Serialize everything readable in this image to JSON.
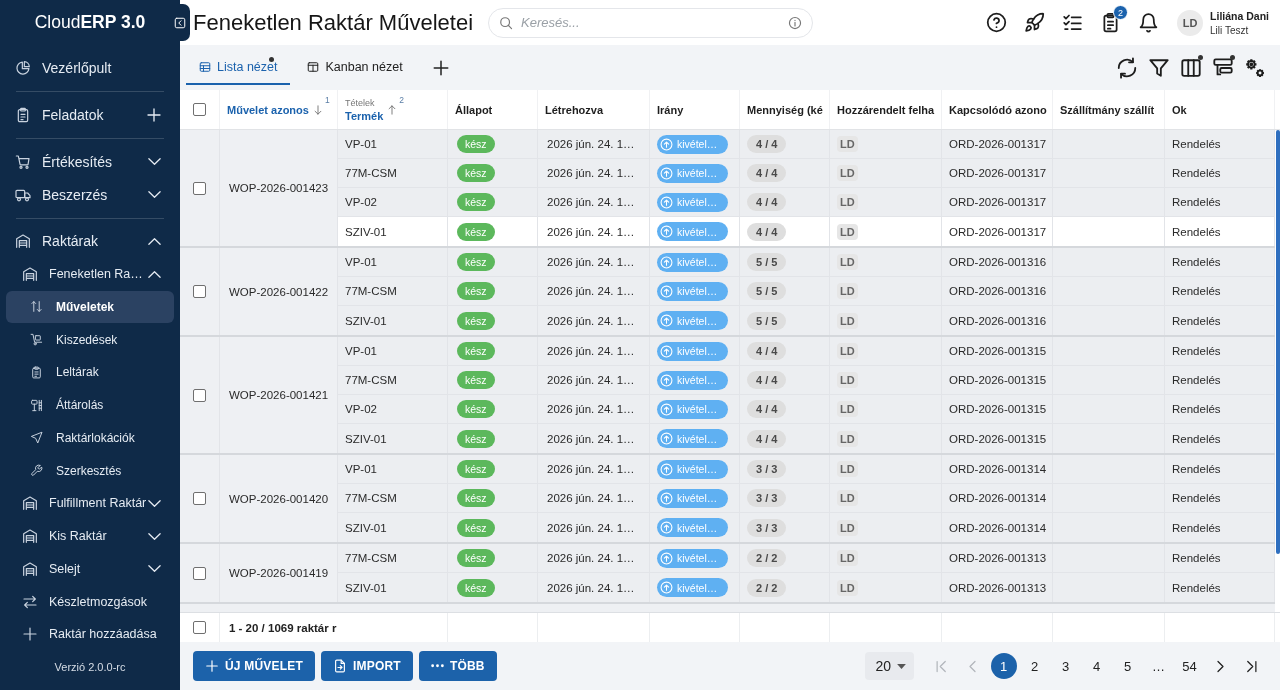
{
  "app": {
    "brand": "Cloud**ERP 3.0**",
    "version": "Verzió 2.0.0-rc"
  },
  "sidebar": {
    "sections": [
      {
        "items": [
          {
            "label": "Vezérlőpult",
            "selected": false
          }
        ]
      },
      {
        "items": [
          {
            "label": "Feladatok",
            "add_button": true,
            "selected": false
          }
        ]
      },
      {
        "items": [
          {
            "label": "Értékesítés",
            "expanded": false,
            "selected": false
          },
          {
            "label": "Beszerzés",
            "expanded": false,
            "selected": false
          }
        ]
      },
      {
        "items": [
          {
            "label": "Raktárak",
            "expanded": true,
            "selected": false,
            "children": [
              {
                "label": "Feneketlen Ra…",
                "expanded": true,
                "selected": false,
                "children": [
                  {
                    "label": "Műveletek",
                    "selected": true
                  },
                  {
                    "label": "Kiszedések",
                    "selected": false
                  },
                  {
                    "label": "Leltárak",
                    "selected": false
                  },
                  {
                    "label": "Áttárolás",
                    "selected": false
                  },
                  {
                    "label": "Raktárlokációk",
                    "selected": false
                  },
                  {
                    "label": "Szerkesztés",
                    "selected": false
                  }
                ]
              },
              {
                "label": "Fulfillment Raktár",
                "expanded": false,
                "selected": false
              },
              {
                "label": "Kis Raktár",
                "expanded": false,
                "selected": false
              },
              {
                "label": "Selejt",
                "expanded": false,
                "selected": false
              },
              {
                "label": "Készletmozgások",
                "selected": false
              },
              {
                "label": "Raktár hozzáadása",
                "selected": false
              }
            ]
          }
        ]
      }
    ]
  },
  "header": {
    "title": "Feneketlen Raktár Műveletei",
    "search": {
      "placeholder": "Keresés..."
    },
    "badge": "2",
    "user": {
      "initials": "LD",
      "name": "Liliána Dani",
      "role": "Lili Teszt"
    }
  },
  "toolbar": {
    "tabs": [
      {
        "label": "Lista nézet",
        "selected": true,
        "indicator": true
      },
      {
        "label": "Kanban nézet",
        "selected": false,
        "indicator": false
      }
    ],
    "actions": [
      {
        "indicator": false
      },
      {
        "indicator": false
      },
      {
        "indicator": true
      },
      {
        "indicator": true
      },
      {
        "indicator": false
      }
    ]
  },
  "table": {
    "select_all": false,
    "columns": [
      {
        "label": "Művelet azonos",
        "sort": {
          "descending": true,
          "index": "1"
        }
      },
      {
        "group_label": "Tételek",
        "label": "Termék",
        "sort": {
          "descending": false,
          "index": "2"
        }
      },
      {
        "label": "Állapot"
      },
      {
        "label": "Létrehozva"
      },
      {
        "label": "Irány"
      },
      {
        "label": "Mennyiség (ké"
      },
      {
        "label": "Hozzárendelt felha"
      },
      {
        "label": "Kapcsolódó azono"
      },
      {
        "label": "Szállítmány szállít"
      },
      {
        "label": "Ok"
      }
    ],
    "groups": [
      {
        "id": "WOP-2026-001423",
        "checked": false,
        "items": [
          {
            "product": "VP-01",
            "status": "kész",
            "created": "2026 jún. 24. 1…",
            "direction": "kivétel…",
            "quantity": "4 / 4",
            "assignee": "LD",
            "related": "ORD-2026-001317",
            "reason": "Rendelés",
            "hovered": false
          },
          {
            "product": "77M-CSM",
            "status": "kész",
            "created": "2026 jún. 24. 1…",
            "direction": "kivétel…",
            "quantity": "4 / 4",
            "assignee": "LD",
            "related": "ORD-2026-001317",
            "reason": "Rendelés",
            "hovered": false
          },
          {
            "product": "VP-02",
            "status": "kész",
            "created": "2026 jún. 24. 1…",
            "direction": "kivétel…",
            "quantity": "4 / 4",
            "assignee": "LD",
            "related": "ORD-2026-001317",
            "reason": "Rendelés",
            "hovered": false
          },
          {
            "product": "SZIV-01",
            "status": "kész",
            "created": "2026 jún. 24. 1…",
            "direction": "kivétel…",
            "quantity": "4 / 4",
            "assignee": "LD",
            "related": "ORD-2026-001317",
            "reason": "Rendelés",
            "hovered": true
          }
        ]
      },
      {
        "id": "WOP-2026-001422",
        "checked": false,
        "items": [
          {
            "product": "VP-01",
            "status": "kész",
            "created": "2026 jún. 24. 1…",
            "direction": "kivétel…",
            "quantity": "5 / 5",
            "assignee": "LD",
            "related": "ORD-2026-001316",
            "reason": "Rendelés",
            "hovered": false
          },
          {
            "product": "77M-CSM",
            "status": "kész",
            "created": "2026 jún. 24. 1…",
            "direction": "kivétel…",
            "quantity": "5 / 5",
            "assignee": "LD",
            "related": "ORD-2026-001316",
            "reason": "Rendelés",
            "hovered": false
          },
          {
            "product": "SZIV-01",
            "status": "kész",
            "created": "2026 jún. 24. 1…",
            "direction": "kivétel…",
            "quantity": "5 / 5",
            "assignee": "LD",
            "related": "ORD-2026-001316",
            "reason": "Rendelés",
            "hovered": false
          }
        ]
      },
      {
        "id": "WOP-2026-001421",
        "checked": false,
        "items": [
          {
            "product": "VP-01",
            "status": "kész",
            "created": "2026 jún. 24. 1…",
            "direction": "kivétel…",
            "quantity": "4 / 4",
            "assignee": "LD",
            "related": "ORD-2026-001315",
            "reason": "Rendelés",
            "hovered": false
          },
          {
            "product": "77M-CSM",
            "status": "kész",
            "created": "2026 jún. 24. 1…",
            "direction": "kivétel…",
            "quantity": "4 / 4",
            "assignee": "LD",
            "related": "ORD-2026-001315",
            "reason": "Rendelés",
            "hovered": false
          },
          {
            "product": "VP-02",
            "status": "kész",
            "created": "2026 jún. 24. 1…",
            "direction": "kivétel…",
            "quantity": "4 / 4",
            "assignee": "LD",
            "related": "ORD-2026-001315",
            "reason": "Rendelés",
            "hovered": false
          },
          {
            "product": "SZIV-01",
            "status": "kész",
            "created": "2026 jún. 24. 1…",
            "direction": "kivétel…",
            "quantity": "4 / 4",
            "assignee": "LD",
            "related": "ORD-2026-001315",
            "reason": "Rendelés",
            "hovered": false
          }
        ]
      },
      {
        "id": "WOP-2026-001420",
        "checked": false,
        "items": [
          {
            "product": "VP-01",
            "status": "kész",
            "created": "2026 jún. 24. 1…",
            "direction": "kivétel…",
            "quantity": "3 / 3",
            "assignee": "LD",
            "related": "ORD-2026-001314",
            "reason": "Rendelés",
            "hovered": false
          },
          {
            "product": "77M-CSM",
            "status": "kész",
            "created": "2026 jún. 24. 1…",
            "direction": "kivétel…",
            "quantity": "3 / 3",
            "assignee": "LD",
            "related": "ORD-2026-001314",
            "reason": "Rendelés",
            "hovered": false
          },
          {
            "product": "SZIV-01",
            "status": "kész",
            "created": "2026 jún. 24. 1…",
            "direction": "kivétel…",
            "quantity": "3 / 3",
            "assignee": "LD",
            "related": "ORD-2026-001314",
            "reason": "Rendelés",
            "hovered": false
          }
        ]
      },
      {
        "id": "WOP-2026-001419",
        "checked": false,
        "items": [
          {
            "product": "77M-CSM",
            "status": "kész",
            "created": "2026 jún. 24. 1…",
            "direction": "kivétel…",
            "quantity": "2 / 2",
            "assignee": "LD",
            "related": "ORD-2026-001313",
            "reason": "Rendelés",
            "hovered": false
          },
          {
            "product": "SZIV-01",
            "status": "kész",
            "created": "2026 jún. 24. 1…",
            "direction": "kivétel…",
            "quantity": "2 / 2",
            "assignee": "LD",
            "related": "ORD-2026-001313",
            "reason": "Rendelés",
            "hovered": false
          }
        ]
      }
    ],
    "footer": {
      "checked": false,
      "summary": "1 - 20 / 1069 raktár r"
    }
  },
  "bottom": {
    "actions": [
      {
        "label": "ÚJ MŰVELET"
      },
      {
        "label": "IMPORT"
      },
      {
        "label": "TÖBB"
      }
    ]
  },
  "pagination": {
    "page_size": "20",
    "nav_before": [
      {
        "disabled": true
      },
      {
        "disabled": true
      }
    ],
    "pages": [
      {
        "label": "1",
        "selected": true
      },
      {
        "label": "2",
        "selected": false
      },
      {
        "label": "3",
        "selected": false
      },
      {
        "label": "4",
        "selected": false
      },
      {
        "label": "5",
        "selected": false
      }
    ],
    "ellipsis": "…",
    "last_pages": [
      {
        "label": "54",
        "selected": false
      }
    ],
    "nav_after": [
      {
        "disabled": false
      },
      {
        "disabled": false
      }
    ]
  }
}
